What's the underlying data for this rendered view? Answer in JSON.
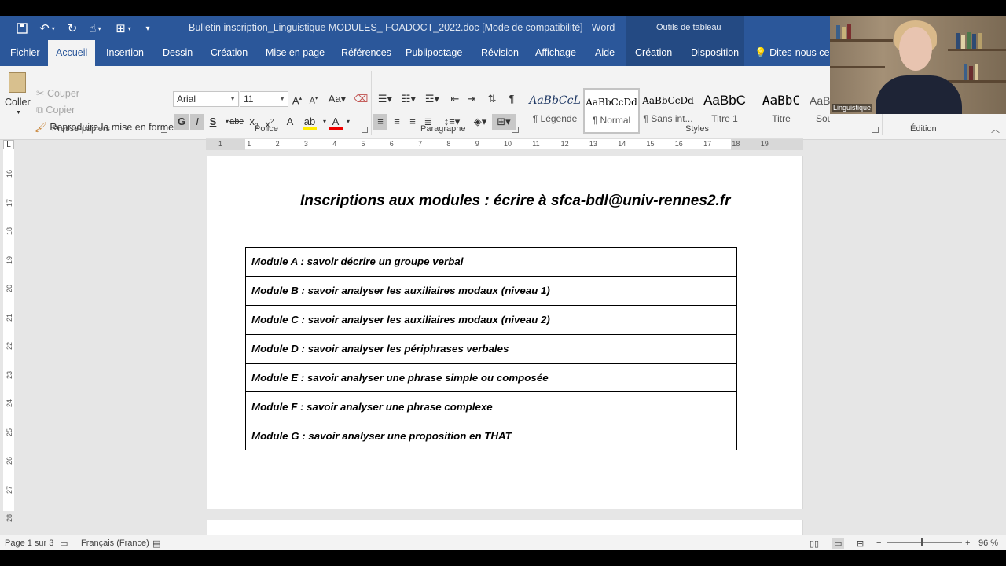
{
  "title_bar": {
    "document_title": "Bulletin inscription_Linguistique MODULES_ FOADOCT_2022.doc [Mode de compatibilité]  -  Word",
    "table_tools": "Outils de tableau"
  },
  "tabs": {
    "fichier": "Fichier",
    "accueil": "Accueil",
    "insertion": "Insertion",
    "dessin": "Dessin",
    "creation": "Création",
    "mise_en_page": "Mise en page",
    "references": "Références",
    "publipostage": "Publipostage",
    "revision": "Révision",
    "affichage": "Affichage",
    "aide": "Aide",
    "creation_table": "Création",
    "disposition": "Disposition",
    "tell_me": "Dites-nous ce q"
  },
  "ribbon": {
    "clipboard": {
      "paste": "Coller",
      "cut": "Couper",
      "copy": "Copier",
      "format_painter": "Reproduire la mise en forme",
      "label": "Presse-papiers"
    },
    "font": {
      "font_name": "Arial",
      "font_size": "11",
      "bold": "G",
      "italic": "I",
      "underline": "S",
      "strike": "abc",
      "label": "Police"
    },
    "paragraph": {
      "label": "Paragraphe"
    },
    "styles": {
      "label": "Styles",
      "items": [
        {
          "sample": "AaBbCcL",
          "name": "¶ Légende"
        },
        {
          "sample": "AaBbCcDd",
          "name": "¶ Normal"
        },
        {
          "sample": "AaBbCcDd",
          "name": "¶ Sans int..."
        },
        {
          "sample": "AaBbC",
          "name": "Titre 1"
        },
        {
          "sample": "AaBbC",
          "name": "Titre"
        },
        {
          "sample": "AaBb",
          "name": "Sous"
        }
      ]
    },
    "editing": {
      "label": "Édition"
    }
  },
  "ruler": {
    "horizontal": [
      "1",
      "1",
      "2",
      "3",
      "4",
      "5",
      "6",
      "7",
      "8",
      "9",
      "10",
      "11",
      "12",
      "13",
      "14",
      "15",
      "16",
      "17",
      "18",
      "19"
    ],
    "vertical": [
      "16",
      "17",
      "18",
      "19",
      "20",
      "21",
      "22",
      "23",
      "24",
      "25",
      "26",
      "27",
      "28"
    ]
  },
  "document": {
    "heading": "Inscriptions aux modules : écrire à sfca-bdl@univ-rennes2.fr",
    "modules": [
      "Module A : savoir décrire un groupe verbal",
      "Module B : savoir analyser les auxiliaires modaux (niveau 1)",
      "Module C : savoir analyser les auxiliaires modaux (niveau 2)",
      "Module D : savoir analyser les périphrases verbales",
      "Module E : savoir analyser une phrase simple ou composée",
      "Module F : savoir analyser une phrase complexe",
      "Module G : savoir analyser une proposition en THAT"
    ]
  },
  "status_bar": {
    "page": "Page 1 sur 3",
    "language": "Français (France)",
    "zoom": "96 %"
  },
  "webcam": {
    "label": "Linguistique"
  },
  "colors": {
    "word_blue": "#2b579a",
    "ribbon_bg": "#f3f3f3",
    "doc_bg": "#e6e6e6"
  }
}
